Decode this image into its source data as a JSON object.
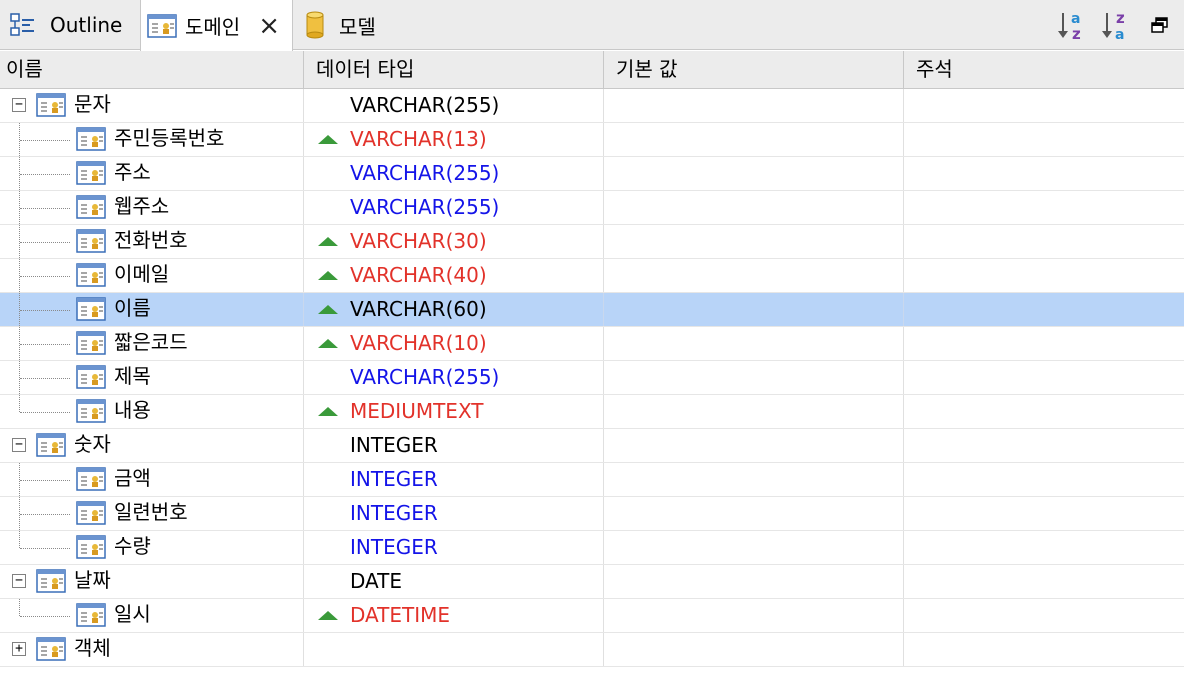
{
  "tabs": [
    {
      "label": "Outline",
      "icon": "outline-icon"
    },
    {
      "label": "도메인",
      "icon": "domain-icon",
      "active": true
    },
    {
      "label": "모델",
      "icon": "model-cylinder-icon"
    }
  ],
  "toolbar": [
    "sort-az-icon",
    "sort-za-icon",
    "restore-window-icon"
  ],
  "columns": [
    "이름",
    "데이터 타입",
    "기본 값",
    "주석"
  ],
  "colors": {
    "red": "#e2322a",
    "blue": "#1414e8",
    "black": "#000000",
    "selected": "#b8d4f8"
  },
  "rows": [
    {
      "name": "문자",
      "type": "VARCHAR(255)",
      "level": 0,
      "expand": "−",
      "color": "#000000",
      "tri": false
    },
    {
      "name": "주민등록번호",
      "type": "VARCHAR(13)",
      "level": 1,
      "color": "#e2322a",
      "tri": true
    },
    {
      "name": "주소",
      "type": "VARCHAR(255)",
      "level": 1,
      "color": "#1414e8",
      "tri": false
    },
    {
      "name": "웹주소",
      "type": "VARCHAR(255)",
      "level": 1,
      "color": "#1414e8",
      "tri": false
    },
    {
      "name": "전화번호",
      "type": "VARCHAR(30)",
      "level": 1,
      "color": "#e2322a",
      "tri": true
    },
    {
      "name": "이메일",
      "type": "VARCHAR(40)",
      "level": 1,
      "color": "#e2322a",
      "tri": true
    },
    {
      "name": "이름",
      "type": "VARCHAR(60)",
      "level": 1,
      "color": "#000000",
      "tri": true,
      "selected": true
    },
    {
      "name": "짧은코드",
      "type": "VARCHAR(10)",
      "level": 1,
      "color": "#e2322a",
      "tri": true
    },
    {
      "name": "제목",
      "type": "VARCHAR(255)",
      "level": 1,
      "color": "#1414e8",
      "tri": false
    },
    {
      "name": "내용",
      "type": "MEDIUMTEXT",
      "level": 1,
      "color": "#e2322a",
      "tri": true
    },
    {
      "name": "숫자",
      "type": "INTEGER",
      "level": 0,
      "expand": "−",
      "color": "#000000",
      "tri": false
    },
    {
      "name": "금액",
      "type": "INTEGER",
      "level": 1,
      "color": "#1414e8",
      "tri": false
    },
    {
      "name": "일련번호",
      "type": "INTEGER",
      "level": 1,
      "color": "#1414e8",
      "tri": false
    },
    {
      "name": "수량",
      "type": "INTEGER",
      "level": 1,
      "color": "#1414e8",
      "tri": false
    },
    {
      "name": "날짜",
      "type": "DATE",
      "level": 0,
      "expand": "−",
      "color": "#000000",
      "tri": false
    },
    {
      "name": "일시",
      "type": "DATETIME",
      "level": 1,
      "color": "#e2322a",
      "tri": true
    },
    {
      "name": "객체",
      "type": "",
      "level": 0,
      "expand": "+",
      "color": "#000000",
      "tri": false
    }
  ]
}
